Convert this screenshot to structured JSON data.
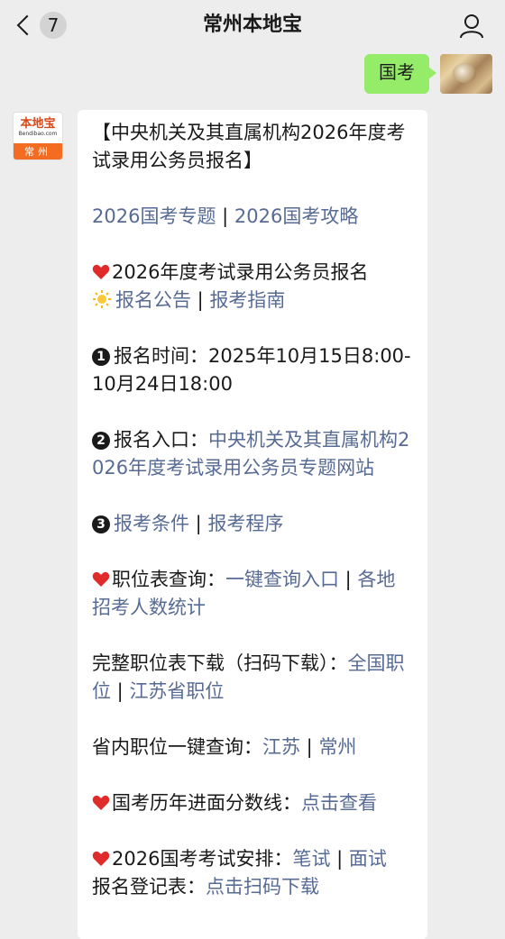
{
  "header": {
    "title": "常州本地宝",
    "unread_count": "7"
  },
  "outgoing": {
    "text": "国考"
  },
  "bot": {
    "logo_name": "本地宝",
    "logo_domain": "Bendibao.com",
    "logo_city": "常州"
  },
  "message": {
    "heading": "【中央机关及其直属机构2026年度考试录用公务员报名】",
    "links1": {
      "a": "2026国考专题",
      "sep": " | ",
      "b": "2026国考攻略"
    },
    "sec1": {
      "text": "2026年度考试录用公务员报名",
      "link_a": "报名公告",
      "sep": " | ",
      "link_b": "报考指南"
    },
    "sec2": {
      "num": "1",
      "text": "报名时间：2025年10月15日8:00-10月24日18:00"
    },
    "sec3": {
      "num": "2",
      "label": "报名入口：",
      "link": "中央机关及其直属机构2026年度考试录用公务员专题网站"
    },
    "sec4": {
      "num": "3",
      "link_a": "报考条件",
      "sep": " | ",
      "link_b": "报考程序"
    },
    "sec5": {
      "label": "职位表查询：",
      "link_a": "一键查询入口",
      "sep": " | ",
      "link_b": "各地招考人数统计"
    },
    "sec6": {
      "label": "完整职位表下载（扫码下载）：",
      "link_a": "全国职位",
      "sep": " | ",
      "link_b": "江苏省职位"
    },
    "sec7": {
      "label": "省内职位一键查询：",
      "link_a": "江苏",
      "sep": " | ",
      "link_b": "常州"
    },
    "sec8": {
      "label": "国考历年进面分数线：",
      "link": "点击查看"
    },
    "sec9": {
      "label": "2026国考考试安排：",
      "link_a": "笔试",
      "sep": " | ",
      "link_b": "面试"
    },
    "sec10": {
      "label": "报名登记表：",
      "link": "点击扫码下载"
    }
  },
  "colors": {
    "link": "#576b95",
    "outgoing_bubble": "#95ec69",
    "background": "#ededed",
    "heart": "#e02b2b"
  },
  "icons": {
    "back": "chevron-left-icon",
    "profile": "person-icon",
    "heart": "heart-icon",
    "sun": "sun-icon"
  }
}
